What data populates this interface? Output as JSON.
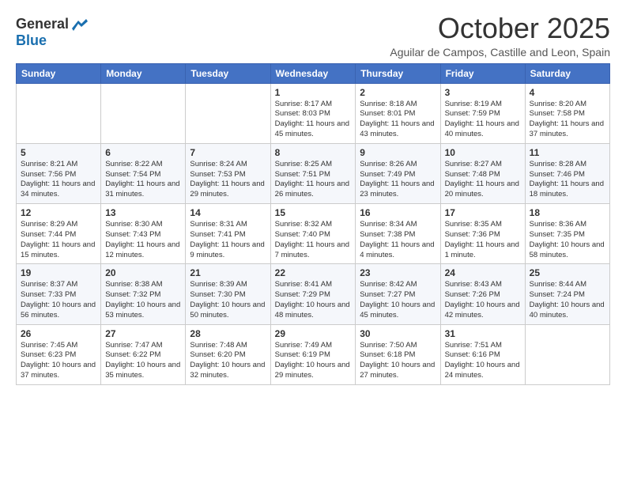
{
  "header": {
    "logo": {
      "general": "General",
      "blue": "Blue"
    },
    "month": "October 2025",
    "location": "Aguilar de Campos, Castille and Leon, Spain"
  },
  "weekdays": [
    "Sunday",
    "Monday",
    "Tuesday",
    "Wednesday",
    "Thursday",
    "Friday",
    "Saturday"
  ],
  "weeks": [
    [
      {
        "num": "",
        "info": ""
      },
      {
        "num": "",
        "info": ""
      },
      {
        "num": "",
        "info": ""
      },
      {
        "num": "1",
        "info": "Sunrise: 8:17 AM\nSunset: 8:03 PM\nDaylight: 11 hours and 45 minutes."
      },
      {
        "num": "2",
        "info": "Sunrise: 8:18 AM\nSunset: 8:01 PM\nDaylight: 11 hours and 43 minutes."
      },
      {
        "num": "3",
        "info": "Sunrise: 8:19 AM\nSunset: 7:59 PM\nDaylight: 11 hours and 40 minutes."
      },
      {
        "num": "4",
        "info": "Sunrise: 8:20 AM\nSunset: 7:58 PM\nDaylight: 11 hours and 37 minutes."
      }
    ],
    [
      {
        "num": "5",
        "info": "Sunrise: 8:21 AM\nSunset: 7:56 PM\nDaylight: 11 hours and 34 minutes."
      },
      {
        "num": "6",
        "info": "Sunrise: 8:22 AM\nSunset: 7:54 PM\nDaylight: 11 hours and 31 minutes."
      },
      {
        "num": "7",
        "info": "Sunrise: 8:24 AM\nSunset: 7:53 PM\nDaylight: 11 hours and 29 minutes."
      },
      {
        "num": "8",
        "info": "Sunrise: 8:25 AM\nSunset: 7:51 PM\nDaylight: 11 hours and 26 minutes."
      },
      {
        "num": "9",
        "info": "Sunrise: 8:26 AM\nSunset: 7:49 PM\nDaylight: 11 hours and 23 minutes."
      },
      {
        "num": "10",
        "info": "Sunrise: 8:27 AM\nSunset: 7:48 PM\nDaylight: 11 hours and 20 minutes."
      },
      {
        "num": "11",
        "info": "Sunrise: 8:28 AM\nSunset: 7:46 PM\nDaylight: 11 hours and 18 minutes."
      }
    ],
    [
      {
        "num": "12",
        "info": "Sunrise: 8:29 AM\nSunset: 7:44 PM\nDaylight: 11 hours and 15 minutes."
      },
      {
        "num": "13",
        "info": "Sunrise: 8:30 AM\nSunset: 7:43 PM\nDaylight: 11 hours and 12 minutes."
      },
      {
        "num": "14",
        "info": "Sunrise: 8:31 AM\nSunset: 7:41 PM\nDaylight: 11 hours and 9 minutes."
      },
      {
        "num": "15",
        "info": "Sunrise: 8:32 AM\nSunset: 7:40 PM\nDaylight: 11 hours and 7 minutes."
      },
      {
        "num": "16",
        "info": "Sunrise: 8:34 AM\nSunset: 7:38 PM\nDaylight: 11 hours and 4 minutes."
      },
      {
        "num": "17",
        "info": "Sunrise: 8:35 AM\nSunset: 7:36 PM\nDaylight: 11 hours and 1 minute."
      },
      {
        "num": "18",
        "info": "Sunrise: 8:36 AM\nSunset: 7:35 PM\nDaylight: 10 hours and 58 minutes."
      }
    ],
    [
      {
        "num": "19",
        "info": "Sunrise: 8:37 AM\nSunset: 7:33 PM\nDaylight: 10 hours and 56 minutes."
      },
      {
        "num": "20",
        "info": "Sunrise: 8:38 AM\nSunset: 7:32 PM\nDaylight: 10 hours and 53 minutes."
      },
      {
        "num": "21",
        "info": "Sunrise: 8:39 AM\nSunset: 7:30 PM\nDaylight: 10 hours and 50 minutes."
      },
      {
        "num": "22",
        "info": "Sunrise: 8:41 AM\nSunset: 7:29 PM\nDaylight: 10 hours and 48 minutes."
      },
      {
        "num": "23",
        "info": "Sunrise: 8:42 AM\nSunset: 7:27 PM\nDaylight: 10 hours and 45 minutes."
      },
      {
        "num": "24",
        "info": "Sunrise: 8:43 AM\nSunset: 7:26 PM\nDaylight: 10 hours and 42 minutes."
      },
      {
        "num": "25",
        "info": "Sunrise: 8:44 AM\nSunset: 7:24 PM\nDaylight: 10 hours and 40 minutes."
      }
    ],
    [
      {
        "num": "26",
        "info": "Sunrise: 7:45 AM\nSunset: 6:23 PM\nDaylight: 10 hours and 37 minutes."
      },
      {
        "num": "27",
        "info": "Sunrise: 7:47 AM\nSunset: 6:22 PM\nDaylight: 10 hours and 35 minutes."
      },
      {
        "num": "28",
        "info": "Sunrise: 7:48 AM\nSunset: 6:20 PM\nDaylight: 10 hours and 32 minutes."
      },
      {
        "num": "29",
        "info": "Sunrise: 7:49 AM\nSunset: 6:19 PM\nDaylight: 10 hours and 29 minutes."
      },
      {
        "num": "30",
        "info": "Sunrise: 7:50 AM\nSunset: 6:18 PM\nDaylight: 10 hours and 27 minutes."
      },
      {
        "num": "31",
        "info": "Sunrise: 7:51 AM\nSunset: 6:16 PM\nDaylight: 10 hours and 24 minutes."
      },
      {
        "num": "",
        "info": ""
      }
    ]
  ]
}
